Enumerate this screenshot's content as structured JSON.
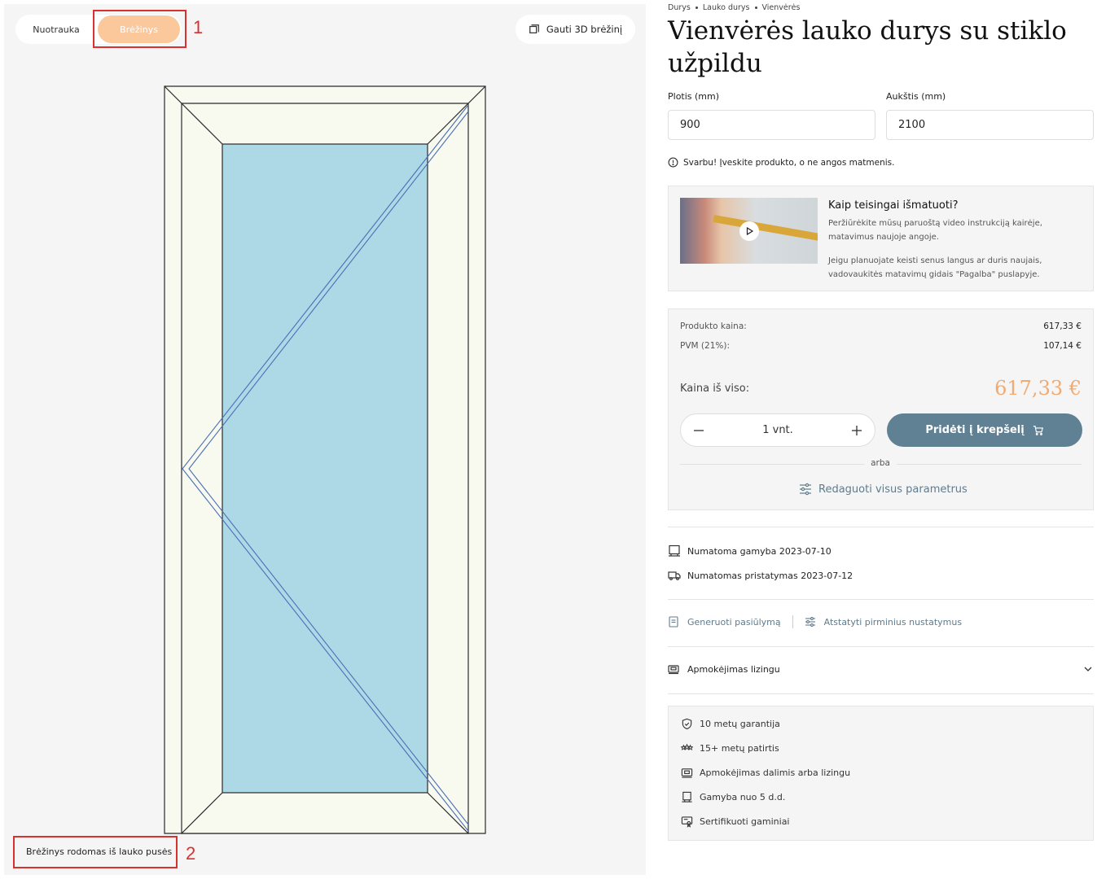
{
  "preview": {
    "tabs": [
      {
        "label": "Nuotrauka",
        "active": false
      },
      {
        "label": "Brėžinys",
        "active": true
      }
    ],
    "btn_3d_label": "Gauti 3D brėžinį",
    "drawing_note": "Brėžinys rodomas iš lauko pusės",
    "callouts": [
      "1",
      "2"
    ],
    "colors": {
      "active_tab": "#fbc89c",
      "glass": "#add8e6",
      "frame": "#f8f9ef",
      "highlight": "#d93030"
    }
  },
  "breadcrumb": [
    "Durys",
    "Lauko durys",
    "Vienvėrės"
  ],
  "product": {
    "title": "Vienvėrės lauko durys su stiklo užpildu",
    "width_label": "Plotis (mm)",
    "width_value": "900",
    "height_label": "Aukštis (mm)",
    "height_value": "2100",
    "notice": "Svarbu! Įveskite produkto, o ne angos matmenis."
  },
  "howto": {
    "title": "Kaip teisingai išmatuoti?",
    "text1": "Peržiūrėkite mūsų paruoštą video instrukciją kairėje, matavimus naujoje angoje.",
    "text2": "Jeigu planuojate keisti senus langus ar duris naujais, vadovaukitės matavimų gidais \"Pagalba\" puslapyje."
  },
  "pricing": {
    "product_price_label": "Produkto kaina:",
    "product_price_value": "617,33 €",
    "vat_label": "PVM (21%):",
    "vat_value": "107,14 €",
    "total_label": "Kaina iš viso:",
    "total_value": "617,33 €",
    "qty_value": "1",
    "qty_unit": "vnt.",
    "add_to_cart": "Pridėti į krepšelį",
    "or_text": "arba",
    "edit_params": "Redaguoti visus parametrus",
    "accent_color": "#f0aa72",
    "button_color": "#5f8193"
  },
  "delivery": {
    "production": "Numatoma gamyba 2023-07-10",
    "shipping": "Numatomas pristatymas 2023-07-12"
  },
  "actions": {
    "generate_offer": "Generuoti pasiūlymą",
    "reset_settings": "Atstatyti pirminius nustatymus"
  },
  "leasing_label": "Apmokėjimas lizingu",
  "benefits": [
    {
      "icon": "shield-check-icon",
      "label": "10 metų garantija"
    },
    {
      "icon": "stars-icon",
      "label": "15+ metų patirtis"
    },
    {
      "icon": "payment-card-icon",
      "label": "Apmokėjimas dalimis arba lizingu"
    },
    {
      "icon": "factory-icon",
      "label": "Gamyba nuo 5 d.d."
    },
    {
      "icon": "certificate-icon",
      "label": "Sertifikuoti gaminiai"
    }
  ]
}
